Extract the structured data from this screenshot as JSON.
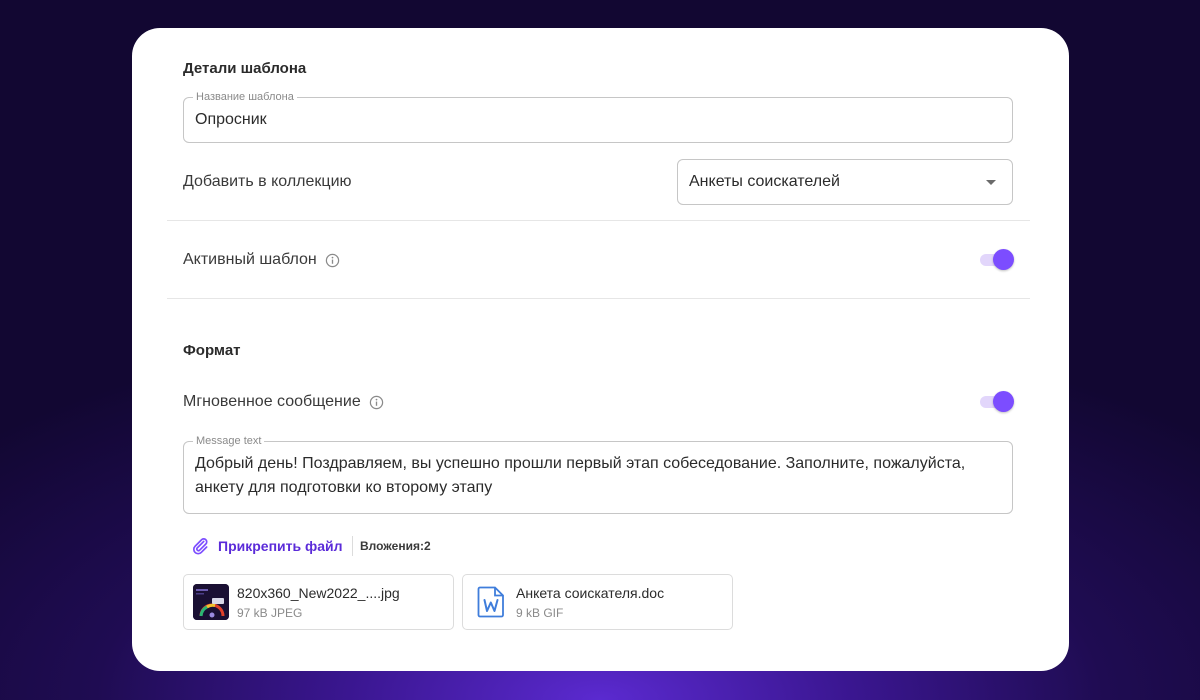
{
  "template_details": {
    "section_title": "Детали шаблона",
    "name_field": {
      "legend": "Название шаблона",
      "value": "Опросник"
    },
    "collection_row": {
      "label": "Добавить в коллекцию",
      "selected": "Анкеты соискателей"
    },
    "active_row": {
      "label": "Активный шаблон",
      "toggle_on": true
    }
  },
  "format": {
    "section_title": "Формат",
    "instant_message_row": {
      "label": "Мгновенное сообщение",
      "toggle_on": true
    },
    "message_field": {
      "legend": "Message text",
      "value": "Добрый день! Поздравляем, вы успешно прошли первый этап собеседование. Заполните, пожалуйста, анкету для подготовки ко второму этапу"
    },
    "attach": {
      "button_label": "Прикрепить файл",
      "count_label": "Вложения:2"
    },
    "files": [
      {
        "name": "820x360_New2022_....jpg",
        "meta": "97 kB JPEG",
        "icon": "image-thumbnail"
      },
      {
        "name": "Анкета соискателя.doc",
        "meta": "9 kB GIF",
        "icon": "word-document-icon"
      }
    ]
  },
  "colors": {
    "accent": "#7c4dff",
    "accent_text": "#5b2bd9",
    "toggle_track": "#e2d6fb"
  }
}
